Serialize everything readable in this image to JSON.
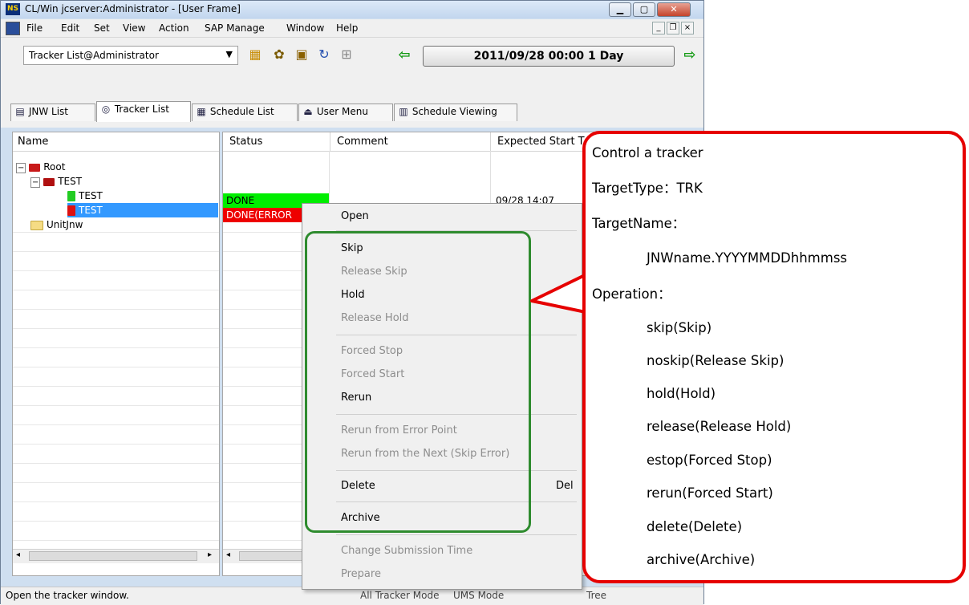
{
  "window": {
    "title": "CL/Win jcserver:Administrator - [User Frame]",
    "app_icon": "NS"
  },
  "menu": [
    "File",
    "Edit",
    "Set",
    "View",
    "Action",
    "SAP Manage",
    "Window",
    "Help"
  ],
  "toolbar": {
    "combo_value": "Tracker List@Administrator",
    "date_display": "2011/09/28 00:00  1 Day"
  },
  "tabs": [
    "JNW List",
    "Tracker List",
    "Schedule List",
    "User Menu",
    "Schedule Viewing"
  ],
  "left_pane": {
    "header": "Name",
    "tree": [
      {
        "label": "Root",
        "level": 0
      },
      {
        "label": "TEST",
        "level": 1
      },
      {
        "label": "TEST",
        "level": 2
      },
      {
        "label": "TEST",
        "level": 2,
        "selected": true
      },
      {
        "label": "UnitJnw",
        "level": 1
      }
    ]
  },
  "right_pane": {
    "columns": [
      "Status",
      "Comment",
      "Expected Start T"
    ],
    "rows": [
      {
        "status": "DONE",
        "status_color": "#00ee00",
        "time": "09/28 14:07"
      },
      {
        "status": "DONE(ERROR",
        "status_color": "#ee0000",
        "time": ""
      }
    ]
  },
  "context_menu": {
    "items": [
      {
        "label": "Open",
        "disabled": false
      },
      {
        "label": "Skip",
        "disabled": false
      },
      {
        "label": "Release Skip",
        "disabled": true
      },
      {
        "label": "Hold",
        "disabled": false
      },
      {
        "label": "Release Hold",
        "disabled": true
      },
      {
        "label": "Forced Stop",
        "disabled": true
      },
      {
        "label": "Forced Start",
        "disabled": true
      },
      {
        "label": "Rerun",
        "disabled": false
      },
      {
        "label": "Rerun from Error Point",
        "disabled": true
      },
      {
        "label": "Rerun from the Next (Skip Error)",
        "disabled": true
      },
      {
        "label": "Delete",
        "disabled": false,
        "shortcut": "Del"
      },
      {
        "label": "Archive",
        "disabled": false
      },
      {
        "label": "Change Submission Time",
        "disabled": true
      },
      {
        "label": "Prepare",
        "disabled": true
      }
    ]
  },
  "statusbar": {
    "message": "Open the tracker window.",
    "mode1": "All Tracker Mode",
    "mode2": "UMS Mode",
    "mode3": "Tree"
  },
  "callout": {
    "title": "Control a tracker",
    "target_type": "TargetType：TRK",
    "target_name_label": "TargetName：",
    "target_name_value": "JNWname.YYYYMMDDhhmmss",
    "operation_label": "Operation：",
    "operations": [
      "skip(Skip)",
      "noskip(Release Skip)",
      "hold(Hold)",
      "release(Release Hold)",
      "estop(Forced Stop)",
      "rerun(Forced Start)",
      "delete(Delete)",
      "archive(Archive)"
    ]
  },
  "colors": {
    "accent_green": "#2e8b2e",
    "callout_red": "#e60000",
    "selection": "#3399ff"
  }
}
